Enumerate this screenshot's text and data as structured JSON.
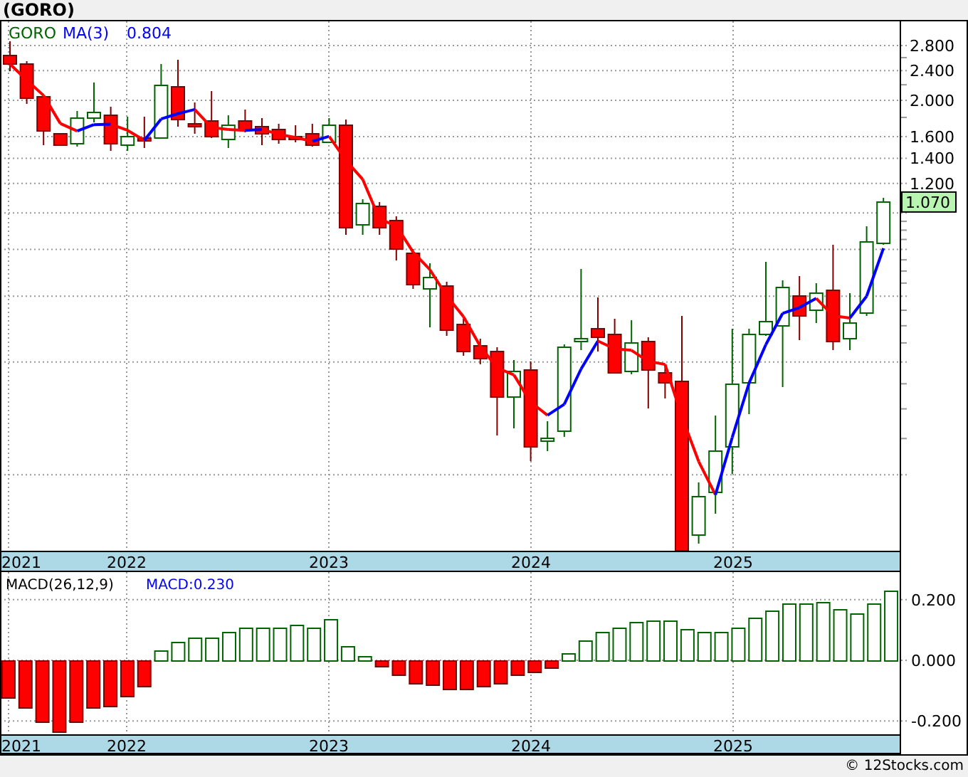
{
  "header": {
    "title": "(GORO)"
  },
  "price_panel": {
    "legend": [
      {
        "text": "GORO",
        "color": "#006400"
      },
      {
        "text": "MA(3)",
        "color": "#0000ff"
      },
      {
        "text": "0.804",
        "color": "#0000ff"
      }
    ],
    "axis_labels": [
      "2.800",
      "2.400",
      "2.000",
      "1.600",
      "1.400",
      "1.200"
    ],
    "last_price": "1.070",
    "date_labels": [
      "2021",
      "2022",
      "2023",
      "2024",
      "2025"
    ]
  },
  "macd_panel": {
    "legend": [
      {
        "text": "MACD:0.230",
        "color": "#0000ff"
      }
    ],
    "chart_data": {
      "type": "bar",
      "title": "MACD(26,12,9)",
      "grid": true,
      "ylim": [
        -0.244,
        0.291
      ],
      "yticks": [
        {
          "value": 0.2,
          "label": "0.200"
        },
        {
          "value": 0,
          "label": "0.000"
        },
        {
          "value": -0.2,
          "label": "-0.200"
        }
      ],
      "values": [
        -0.122,
        -0.153,
        -0.204,
        -0.235,
        -0.204,
        -0.153,
        -0.149,
        -0.116,
        -0.084,
        0.031,
        0.059,
        0.073,
        0.073,
        0.096,
        0.106,
        0.11,
        0.11,
        0.116,
        0.11,
        0.135,
        0.045,
        0.012,
        -0.018,
        -0.049,
        -0.073,
        -0.08,
        -0.092,
        -0.092,
        -0.084,
        -0.073,
        -0.049,
        -0.039,
        -0.024,
        0.022,
        0.065,
        0.092,
        0.106,
        0.127,
        0.131,
        0.131,
        0.102,
        0.092,
        0.092,
        0.11,
        0.139,
        0.163,
        0.188,
        0.188,
        0.192,
        0.167,
        0.157,
        0.188,
        0.229
      ]
    },
    "date_labels": [
      "2021",
      "2022",
      "2023",
      "2024",
      "2025"
    ]
  },
  "footer": {
    "text": "© 12Stocks.com"
  }
}
